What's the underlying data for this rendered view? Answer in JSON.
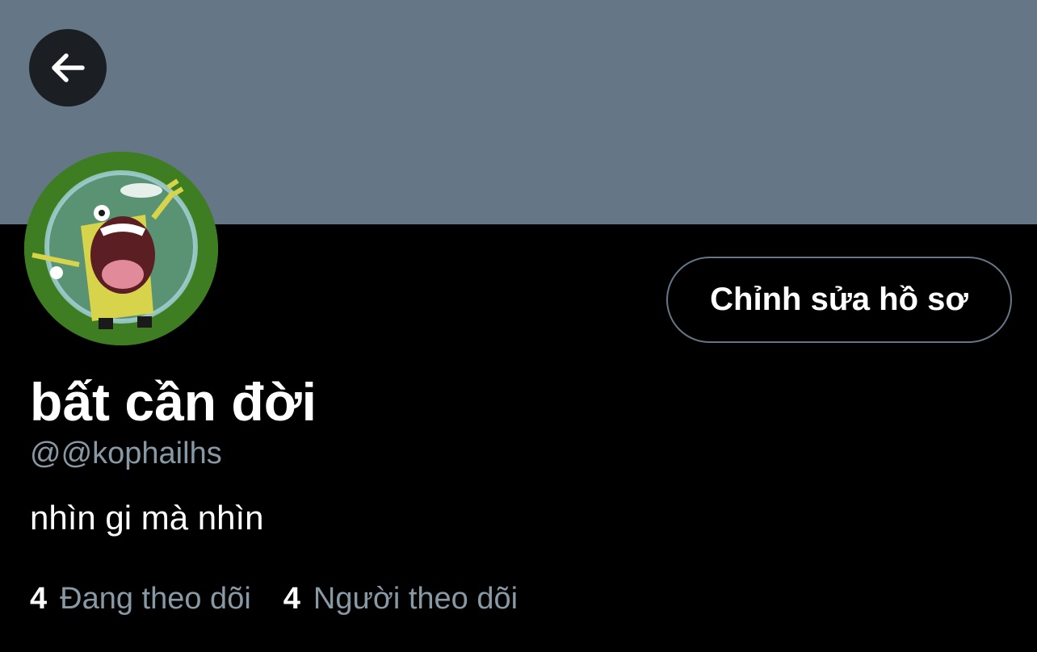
{
  "header": {
    "banner_color": "#657786",
    "back_icon": "arrow-left-icon"
  },
  "profile": {
    "avatar_icon": "spongebob-avatar",
    "edit_button_label": "Chỉnh sửa hồ sơ",
    "display_name": "bất cần đời",
    "handle": "@@kophailhs",
    "bio": "nhìn gi mà nhìn",
    "following": {
      "count": "4",
      "label": "Đang theo dõi"
    },
    "followers": {
      "count": "4",
      "label": "Người theo dõi"
    }
  },
  "colors": {
    "background": "#000000",
    "secondary_text": "#8899a6",
    "button_border": "#657786"
  }
}
